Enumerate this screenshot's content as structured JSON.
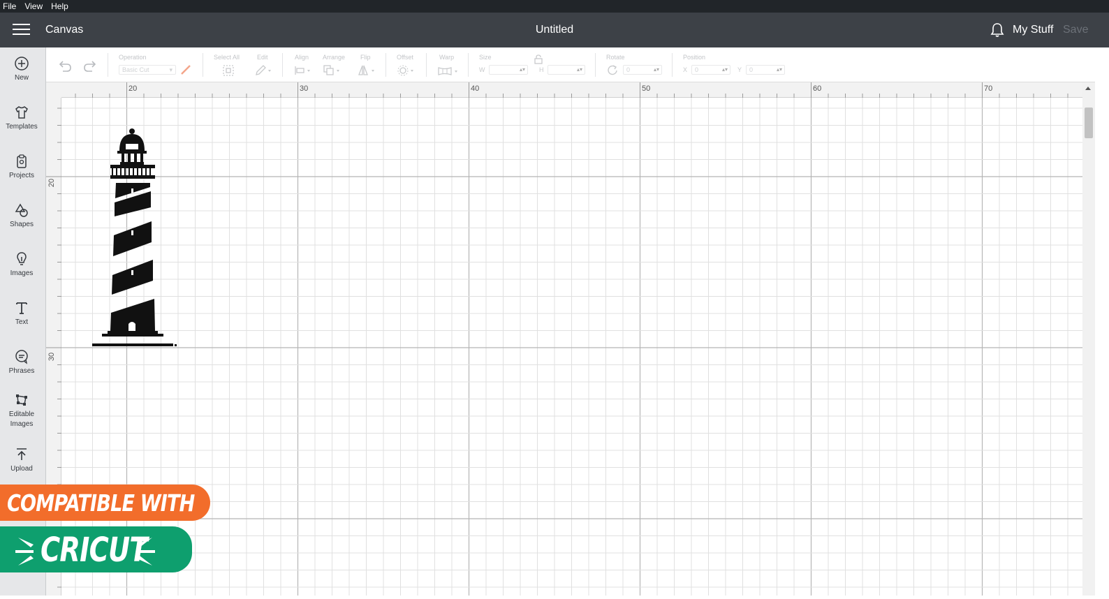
{
  "menu": {
    "file": "File",
    "view": "View",
    "help": "Help"
  },
  "header": {
    "app_name": "Canvas",
    "doc_title": "Untitled",
    "my_stuff": "My Stuff",
    "save": "Save"
  },
  "sidebar": {
    "items": [
      {
        "label": "New",
        "icon": "plus-circle-icon"
      },
      {
        "label": "Templates",
        "icon": "shirt-icon"
      },
      {
        "label": "Projects",
        "icon": "clipboard-icon"
      },
      {
        "label": "Shapes",
        "icon": "shapes-icon"
      },
      {
        "label": "Images",
        "icon": "lightbulb-icon"
      },
      {
        "label": "Text",
        "icon": "text-t-icon"
      },
      {
        "label": "Phrases",
        "icon": "speech-bubble-icon"
      },
      {
        "label": "Editable\nImages",
        "icon": "editable-image-icon"
      },
      {
        "label": "Upload",
        "icon": "upload-icon"
      }
    ]
  },
  "toolbar": {
    "operation_label": "Operation",
    "operation_value": "Basic Cut",
    "select_all": "Select All",
    "edit": "Edit",
    "align": "Align",
    "arrange": "Arrange",
    "flip": "Flip",
    "offset": "Offset",
    "warp": "Warp",
    "size": "Size",
    "w": "W",
    "h": "H",
    "rotate": "Rotate",
    "rotate_value": "0",
    "position": "Position",
    "x": "X",
    "x_value": "0",
    "y": "Y",
    "y_value": "0"
  },
  "rulers": {
    "top": [
      "20",
      "30",
      "40",
      "50",
      "60",
      "70"
    ],
    "left": [
      "20",
      "30"
    ]
  },
  "badges": {
    "compatible": "COMPATIBLE WITH",
    "cricut": "CRICUT"
  },
  "colors": {
    "menubar": "#212529",
    "header": "#3d4147",
    "sidebar": "#e6e7e9",
    "badge_orange": "#f26d2b",
    "badge_green": "#0e9f6e"
  }
}
